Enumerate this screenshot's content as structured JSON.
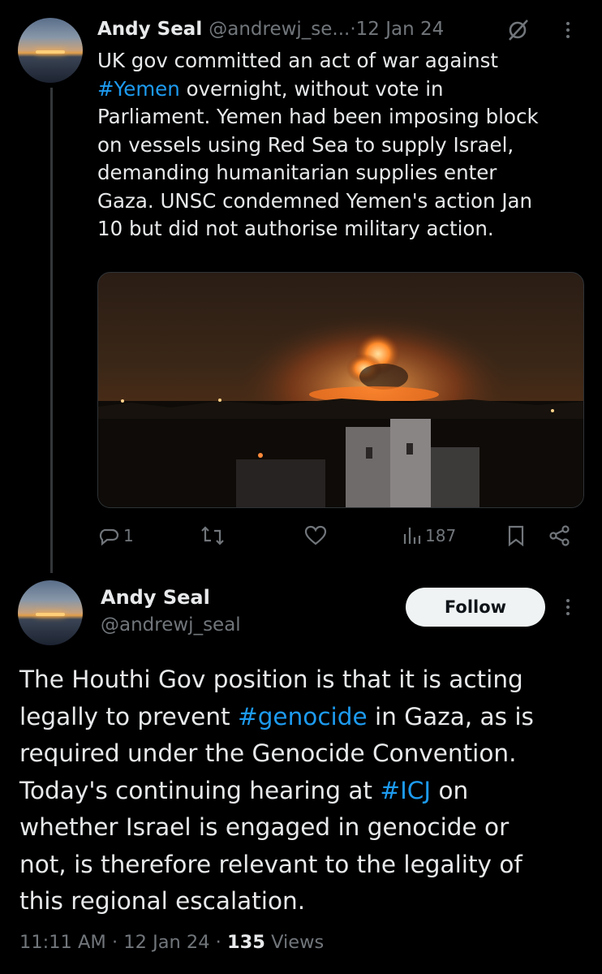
{
  "tweet1": {
    "name": "Andy Seal",
    "handle": "@andrewj_se...",
    "sep": " · ",
    "date": "12 Jan 24",
    "lines": [
      {
        "segments": [
          {
            "text": "UK gov committed an act of war against",
            "tag": false
          }
        ]
      },
      {
        "segments": [
          {
            "text": "#Yemen",
            "tag": true
          },
          {
            "text": " overnight, without vote in",
            "tag": false
          }
        ]
      },
      {
        "segments": [
          {
            "text": "Parliament. Yemen had been imposing block",
            "tag": false
          }
        ]
      },
      {
        "segments": [
          {
            "text": "on vessels using Red Sea to supply Israel,",
            "tag": false
          }
        ]
      },
      {
        "segments": [
          {
            "text": "demanding humanitarian supplies enter",
            "tag": false
          }
        ]
      },
      {
        "segments": [
          {
            "text": "Gaza. UNSC condemned Yemen's action Jan",
            "tag": false
          }
        ]
      },
      {
        "segments": [
          {
            "text": "10 but did not authorise military action.",
            "tag": false
          }
        ]
      }
    ],
    "actions": {
      "replies": "1",
      "views": "187"
    }
  },
  "tweet2": {
    "name": "Andy Seal",
    "handle": "@andrewj_seal",
    "follow_label": "Follow",
    "lines": [
      {
        "segments": [
          {
            "text": "The Houthi Gov position is that it is acting",
            "tag": false
          }
        ]
      },
      {
        "segments": [
          {
            "text": "legally to prevent ",
            "tag": false
          },
          {
            "text": "#genocide",
            "tag": true
          },
          {
            "text": " in Gaza, as is",
            "tag": false
          }
        ]
      },
      {
        "segments": [
          {
            "text": "required under the Genocide Convention.",
            "tag": false
          }
        ]
      },
      {
        "segments": [
          {
            "text": "Today's continuing hearing at ",
            "tag": false
          },
          {
            "text": "#ICJ",
            "tag": true
          },
          {
            "text": " on",
            "tag": false
          }
        ]
      },
      {
        "segments": [
          {
            "text": "whether Israel is engaged in genocide or",
            "tag": false
          }
        ]
      },
      {
        "segments": [
          {
            "text": "not, is therefore relevant to the legality of",
            "tag": false
          }
        ]
      },
      {
        "segments": [
          {
            "text": "this regional escalation.",
            "tag": false
          }
        ]
      }
    ],
    "meta": {
      "time": "11:11 AM",
      "sep": " · ",
      "date": "12 Jan 24",
      "views_count": "135",
      "views_label": " Views"
    }
  },
  "colors": {
    "background": "#000000",
    "text": "#e7e9ea",
    "muted": "#71767b",
    "hashtag": "#1d9bf0",
    "follow_bg": "#eff3f4"
  },
  "icons": [
    "grok-icon",
    "more-icon",
    "reply-icon",
    "repost-icon",
    "like-icon",
    "views-icon",
    "bookmark-icon",
    "share-icon"
  ]
}
